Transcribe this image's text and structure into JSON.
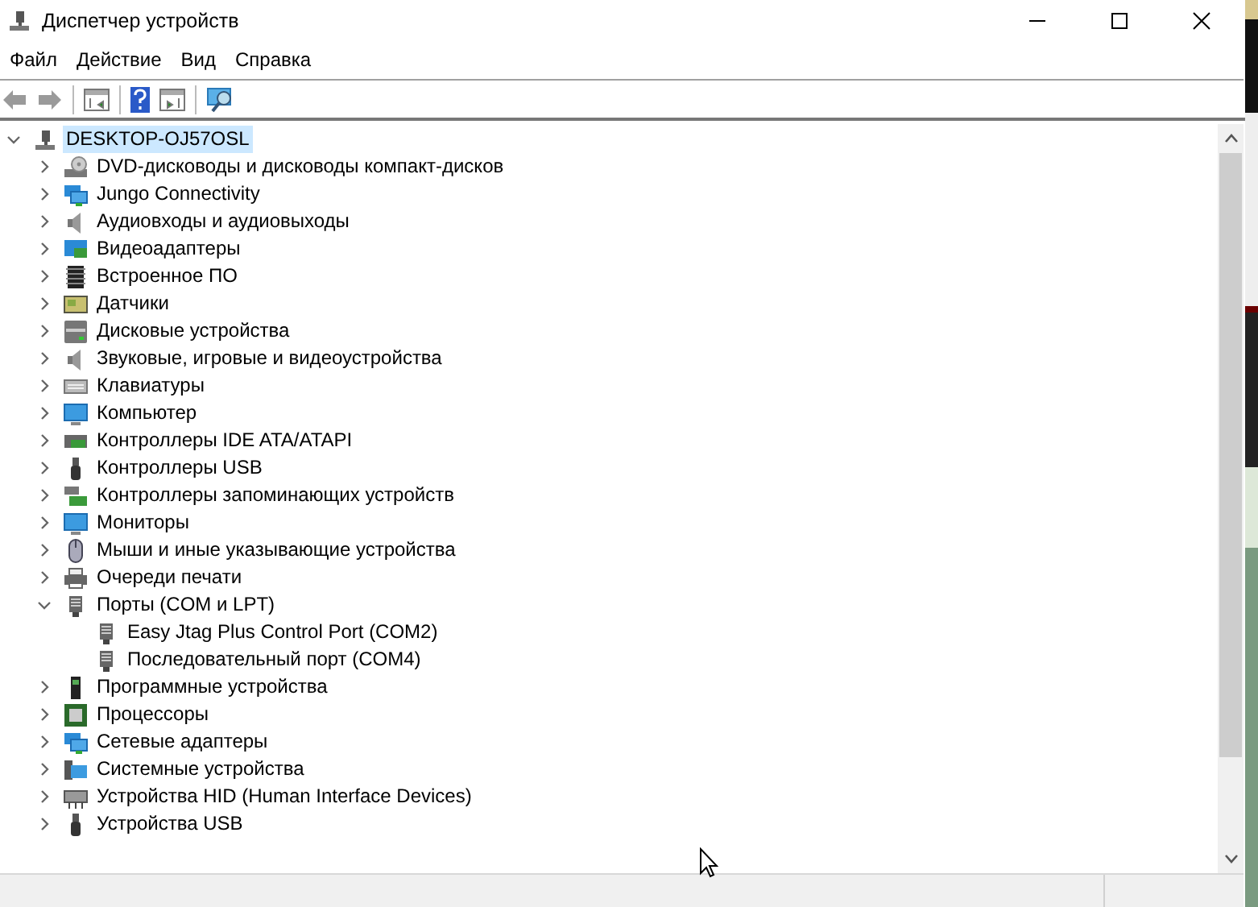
{
  "window": {
    "title": "Диспетчер устройств"
  },
  "menu": [
    "Файл",
    "Действие",
    "Вид",
    "Справка"
  ],
  "tree": [
    {
      "label": "DESKTOP-OJ57OSL",
      "selected": true,
      "expanded": true,
      "children": [
        {
          "label": "DVD-дисководы и дисководы компакт-дисков",
          "selected": false,
          "expanded": false
        },
        {
          "label": "Jungo Connectivity",
          "selected": false,
          "expanded": false
        },
        {
          "label": "Аудиовходы и аудиовыходы",
          "selected": false,
          "expanded": false
        },
        {
          "label": "Видеоадаптеры",
          "selected": false,
          "expanded": false
        },
        {
          "label": "Встроенное ПО",
          "selected": false,
          "expanded": false
        },
        {
          "label": "Датчики",
          "selected": false,
          "expanded": false
        },
        {
          "label": "Дисковые устройства",
          "selected": false,
          "expanded": false
        },
        {
          "label": "Звуковые, игровые и видеоустройства",
          "selected": false,
          "expanded": false
        },
        {
          "label": "Клавиатуры",
          "selected": false,
          "expanded": false
        },
        {
          "label": "Компьютер",
          "selected": false,
          "expanded": false
        },
        {
          "label": "Контроллеры IDE ATA/ATAPI",
          "selected": false,
          "expanded": false
        },
        {
          "label": "Контроллеры USB",
          "selected": false,
          "expanded": false
        },
        {
          "label": "Контроллеры запоминающих устройств",
          "selected": false,
          "expanded": false
        },
        {
          "label": "Мониторы",
          "selected": false,
          "expanded": false
        },
        {
          "label": "Мыши и иные указывающие устройства",
          "selected": false,
          "expanded": false
        },
        {
          "label": "Очереди печати",
          "selected": false,
          "expanded": false
        },
        {
          "label": "Порты (COM и LPT)",
          "selected": false,
          "expanded": true,
          "children": [
            {
              "label": "Easy Jtag Plus Control Port (COM2)",
              "selected": false
            },
            {
              "label": "Последовательный порт (COM4)",
              "selected": false
            }
          ]
        },
        {
          "label": "Программные устройства",
          "selected": false,
          "expanded": false
        },
        {
          "label": "Процессоры",
          "selected": false,
          "expanded": false
        },
        {
          "label": "Сетевые адаптеры",
          "selected": false,
          "expanded": false
        },
        {
          "label": "Системные устройства",
          "selected": false,
          "expanded": false
        },
        {
          "label": "Устройства HID (Human Interface Devices)",
          "selected": false,
          "expanded": false
        },
        {
          "label": "Устройства USB",
          "selected": false,
          "expanded": false
        }
      ]
    }
  ]
}
